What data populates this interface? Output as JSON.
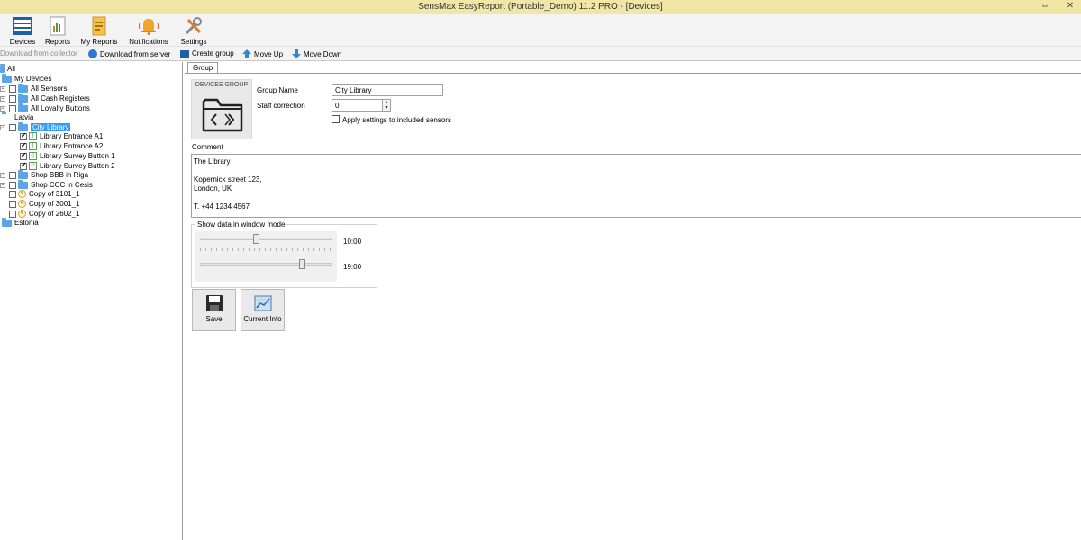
{
  "window": {
    "title": "SensMax EasyReport (Portable_Demo) 11.2 PRO - [Devices]"
  },
  "ribbon": {
    "items": [
      {
        "label": "Devices"
      },
      {
        "label": "Reports"
      },
      {
        "label": "My Reports"
      },
      {
        "label": "Notifications"
      },
      {
        "label": "Settings"
      }
    ]
  },
  "toolbar": {
    "download_collector": "Download from collector",
    "download_server": "Download from server",
    "create_group": "Create group",
    "move_up": "Move Up",
    "move_down": "Move Down"
  },
  "tree": {
    "root": "All",
    "my_devices": "My Devices",
    "all_sensors": "All Sensors",
    "all_cash_registers": "All Cash Registers",
    "all_loyalty_buttons": "All Loyalty Buttons",
    "latvia": "Latvia",
    "city_library": "City Library",
    "library_entrance_a1": "Library Entrance A1",
    "library_entrance_a2": "Library Entrance A2",
    "library_survey_1": "Library Survey Button 1",
    "library_survey_2": "Library Survey Button 2",
    "shop_bbb": "Shop BBB in Riga",
    "shop_ccc": "Shop CCC in Cesis",
    "copy_3101": "Copy of 3101_1",
    "copy_3001": "Copy of 3001_1",
    "copy_2602": "Copy of 2602_1",
    "estonia": "Estonia"
  },
  "panel": {
    "tab": "Group",
    "devices_group_caption": "DEVICES GROUP",
    "group_name_label": "Group Name",
    "group_name_value": "City Library",
    "staff_correction_label": "Staff correction",
    "staff_correction_value": "0",
    "apply_settings_label": "Apply settings to included sensors",
    "comment_label": "Comment",
    "comment_lines": [
      "The Library",
      "",
      "Kopernick street 123,",
      "London, UK",
      "",
      "T. +44 1234 4567"
    ],
    "window_mode_label": "Show data in window mode",
    "slider_start_value": "10:00",
    "slider_end_value": "19:00",
    "save_label": "Save",
    "current_info_label": "Current Info"
  }
}
